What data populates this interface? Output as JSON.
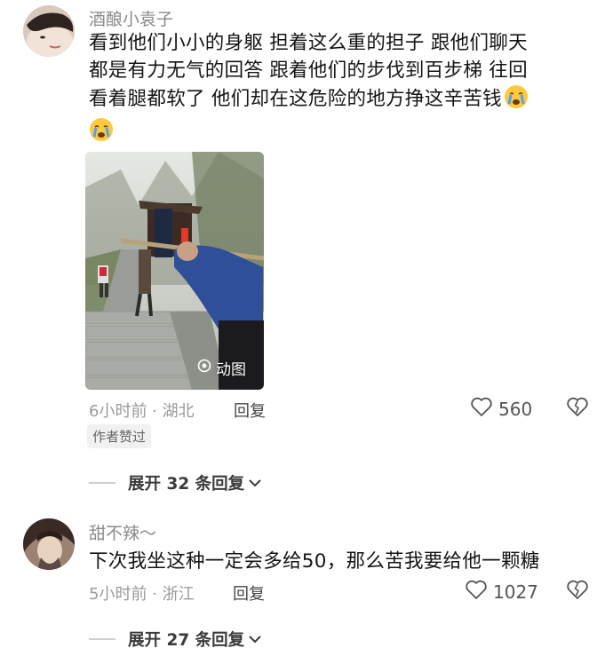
{
  "comments": [
    {
      "username": "酒酿小袁子",
      "lines": [
        "看到他们小小的身躯 担着这么重的担子 跟他们聊天",
        "都是有力无气的回答 跟着他们的步伐到百步梯 往回",
        "看着腿都软了 他们却在这危险的地方挣这辛苦钱"
      ],
      "emoji": "crying-face-emoji",
      "media_label": "动图",
      "time_location": "6小时前 · 湖北",
      "reply_label": "回复",
      "likes": "560",
      "badge": "作者赞过",
      "expand_label": "展开 32 条回复"
    },
    {
      "username": "甜不辣～",
      "text": "下次我坐这种一定会多给50，那么苦我要给他一颗糖",
      "time_location": "5小时前 · 浙江",
      "reply_label": "回复",
      "likes": "1027",
      "expand_label": "展开 27 条回复"
    }
  ],
  "icons": {
    "like": "heart-outline-icon",
    "dislike": "broken-heart-icon",
    "expand": "chevron-down-icon",
    "gif": "gif-play-icon"
  },
  "colors": {
    "meta_text": "#9a9a9a",
    "primary_text": "#141414",
    "badge_bg": "#f1f1f1"
  }
}
